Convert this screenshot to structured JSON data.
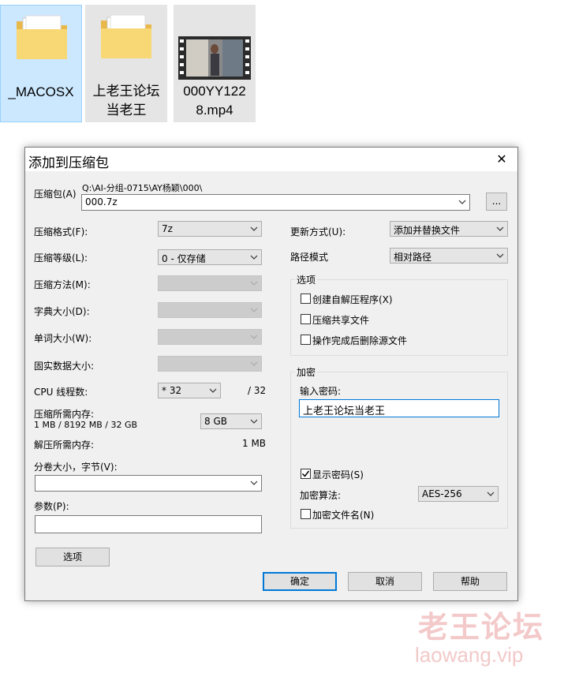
{
  "desktop": {
    "files": [
      {
        "name": "_MACOSX",
        "type": "folder"
      },
      {
        "name": "上老王论坛当老王",
        "type": "folder"
      },
      {
        "name": "000YY1228.mp4",
        "type": "video"
      }
    ]
  },
  "dialog": {
    "title": "添加到压缩包",
    "close_glyph": "✕",
    "archive": {
      "label": "压缩包(A)",
      "path": "Q:\\AI-分组-0715\\AY杨颖\\000\\",
      "value": "000.7z",
      "browse": "..."
    },
    "left": {
      "format": {
        "label": "压缩格式(F):",
        "value": "7z"
      },
      "level": {
        "label": "压缩等级(L):",
        "value": "0 - 仅存储"
      },
      "method": {
        "label": "压缩方法(M):"
      },
      "dict": {
        "label": "字典大小(D):"
      },
      "word": {
        "label": "单词大小(W):"
      },
      "solid": {
        "label": "固实数据大小:"
      },
      "cpu": {
        "label": "CPU 线程数:",
        "value": "* 32",
        "max": "/ 32"
      },
      "mem_compress": {
        "label": "压缩所需内存:",
        "detail": "1 MB / 8192 MB / 32 GB",
        "value": "8 GB"
      },
      "mem_decompress": {
        "label": "解压所需内存:",
        "value": "1 MB"
      },
      "volume": {
        "label": "分卷大小，字节(V):",
        "value": ""
      },
      "params": {
        "label": "参数(P):",
        "value": ""
      },
      "options_button": "选项"
    },
    "right": {
      "update": {
        "label": "更新方式(U):",
        "value": "添加并替换文件"
      },
      "path_mode": {
        "label": "路径模式",
        "value": "相对路径"
      },
      "options_group": {
        "title": "选项",
        "sfx": "创建自解压程序(X)",
        "shared": "压缩共享文件",
        "delete": "操作完成后删除源文件"
      },
      "encryption": {
        "title": "加密",
        "password_label": "输入密码:",
        "password": "上老王论坛当老王",
        "show_password": "显示密码(S)",
        "method_label": "加密算法:",
        "method": "AES-256",
        "encrypt_names": "加密文件名(N)"
      }
    },
    "buttons": {
      "ok": "确定",
      "cancel": "取消",
      "help": "帮助"
    }
  },
  "watermark": {
    "cn": "老王论坛",
    "url": "laowang.vip"
  }
}
